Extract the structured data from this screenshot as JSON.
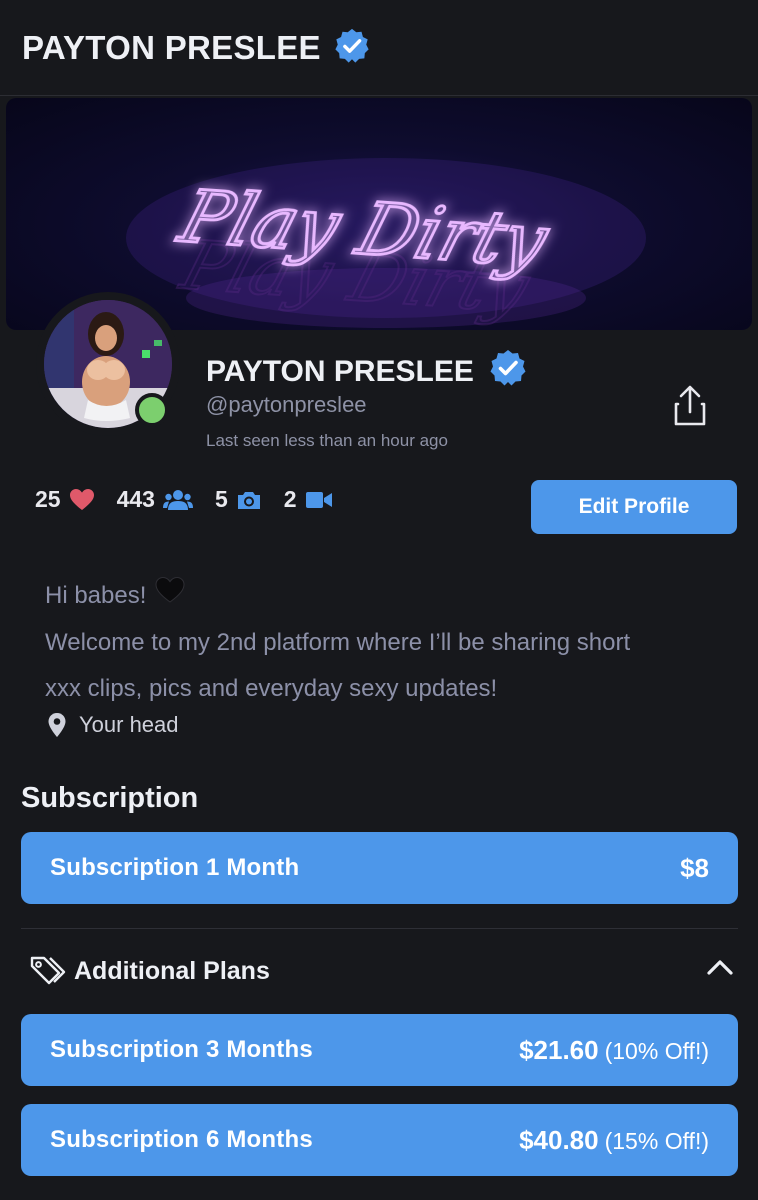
{
  "header": {
    "title": "PAYTON PRESLEE"
  },
  "banner": {
    "neon_text": "Play Dirty"
  },
  "profile": {
    "name": "PAYTON PRESLEE",
    "handle": "@paytonpreslee",
    "last_seen": "Last seen less than an hour ago",
    "online": true
  },
  "stats": {
    "likes": "25",
    "fans": "443",
    "photos": "5",
    "videos": "2"
  },
  "actions": {
    "edit_profile": "Edit Profile"
  },
  "bio": {
    "line1": "Hi babes!",
    "line2": "Welcome to my 2nd platform where I’ll be sharing short",
    "line3": "xxx clips, pics and everyday sexy updates!",
    "location": "Your head"
  },
  "subscription": {
    "title": "Subscription",
    "primary": {
      "label": "Subscription 1 Month",
      "price": "$8"
    },
    "additional_title": "Additional Plans",
    "plans": [
      {
        "label": "Subscription 3 Months",
        "price": "$21.60",
        "discount": "(10% Off!)"
      },
      {
        "label": "Subscription 6 Months",
        "price": "$40.80",
        "discount": "(15% Off!)"
      }
    ]
  },
  "colors": {
    "accent": "#4d97ea",
    "background": "#17181c",
    "online": "#7ccf6e",
    "heart": "#e0596a"
  },
  "icons": [
    "verified-badge-icon",
    "share-icon",
    "heart-icon",
    "users-icon",
    "camera-icon",
    "video-icon",
    "map-pin-icon",
    "tag-icon",
    "chevron-up-icon",
    "black-heart-emoji"
  ]
}
